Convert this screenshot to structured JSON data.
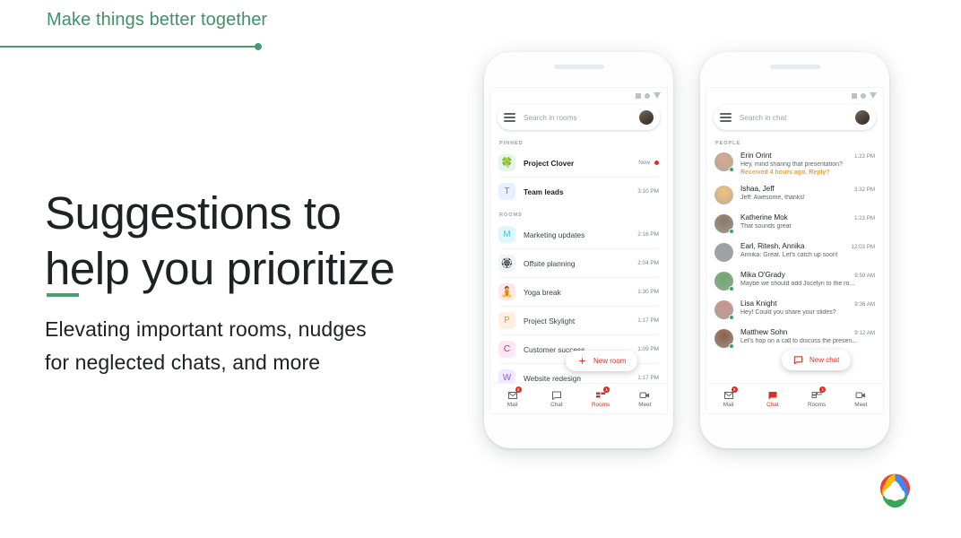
{
  "header": {
    "kicker": "Make things better together"
  },
  "hero": {
    "headline_line1": "Suggestions to",
    "headline_line2": "help you prioritize",
    "subcopy_line1": "Elevating important rooms, nudges",
    "subcopy_line2": "for neglected chats, and more"
  },
  "colors": {
    "green_accent": "#4a9d6e",
    "red_accent": "#d93025",
    "nudge_amber": "#e8a33d",
    "text_primary": "#202124",
    "text_secondary": "#5f6368"
  },
  "phone_left": {
    "app": "rooms",
    "search": {
      "placeholder": "Search in rooms",
      "menu_icon": "hamburger-icon",
      "avatar_icon": "user-avatar"
    },
    "sections": [
      {
        "label": "PINNED",
        "rows": [
          {
            "tile": "🍀",
            "tile_type": "emoji",
            "tile_bg": "#e6f4ea",
            "name": "Project Clover",
            "time": "Now",
            "unread": true,
            "bold": true
          },
          {
            "tile": "T",
            "tile_type": "letter",
            "tile_bg": "#e8f0fe",
            "tile_fg": "#4285f4",
            "name": "Team leads",
            "time": "3:10 PM",
            "unread": false,
            "bold": true
          }
        ]
      },
      {
        "label": "ROOMS",
        "rows": [
          {
            "tile": "M",
            "tile_type": "letter",
            "tile_bg": "#e0f7fa",
            "tile_fg": "#4fc3d7",
            "name": "Marketing updates",
            "time": "2:16 PM",
            "unread": false,
            "bold": false
          },
          {
            "tile": "🏵",
            "tile_type": "emoji",
            "tile_bg": "#f1f3f4",
            "name": "Offsite planning",
            "time": "2:04 PM",
            "unread": false,
            "bold": false
          },
          {
            "tile": "🧘",
            "tile_type": "emoji",
            "tile_bg": "#fce8e6",
            "name": "Yoga break",
            "time": "1:30 PM",
            "unread": false,
            "bold": false
          },
          {
            "tile": "P",
            "tile_type": "letter",
            "tile_bg": "#feefe3",
            "tile_fg": "#f29900",
            "name": "Project Skylight",
            "time": "1:17 PM",
            "unread": false,
            "bold": false
          },
          {
            "tile": "C",
            "tile_type": "letter",
            "tile_bg": "#fde7f3",
            "tile_fg": "#d81b87",
            "name": "Customer success",
            "time": "1:09 PM",
            "unread": false,
            "bold": false
          },
          {
            "tile": "W",
            "tile_type": "letter",
            "tile_bg": "#f3e8fd",
            "tile_fg": "#8e63ce",
            "name": "Website redesign",
            "time": "1:17 PM",
            "unread": false,
            "bold": false
          }
        ]
      }
    ],
    "fab": {
      "label": "New room",
      "icon": "plus-icon"
    },
    "bottom_nav": [
      {
        "label": "Mail",
        "icon": "mail-icon",
        "badge": "2",
        "active": false
      },
      {
        "label": "Chat",
        "icon": "chat-icon",
        "badge": "",
        "active": false
      },
      {
        "label": "Rooms",
        "icon": "rooms-icon",
        "badge": "1",
        "active": true
      },
      {
        "label": "Meet",
        "icon": "meet-icon",
        "badge": "",
        "active": false
      }
    ]
  },
  "phone_right": {
    "app": "chat",
    "search": {
      "placeholder": "Search in chat",
      "menu_icon": "hamburger-icon",
      "avatar_icon": "user-avatar"
    },
    "section_label": "PEOPLE",
    "chats": [
      {
        "name": "Erin Orint",
        "time": "1:23 PM",
        "message": "Hey, mind sharing that presentation?",
        "nudge": "Received 4 hours ago. Reply?",
        "presence": true,
        "avatar_bg": "#d9a88f"
      },
      {
        "name": "Ishaa, Jeff",
        "time": "3:32 PM",
        "message": "Jeff: Awesome, thanks!",
        "nudge": "",
        "presence": false,
        "avatar_bg": "#f0c27b"
      },
      {
        "name": "Katherine Mok",
        "time": "1:23 PM",
        "message": "That sounds great",
        "nudge": "",
        "presence": true,
        "avatar_bg": "#8a7a66"
      },
      {
        "name": "Earl, Ritesh, Annika",
        "time": "12:03 PM",
        "message": "Annika: Great. Let's catch up soon!",
        "nudge": "",
        "presence": false,
        "avatar_bg": "#9aa0a6"
      },
      {
        "name": "Mika O'Grady",
        "time": "9:59 AM",
        "message": "Maybe we should add Jocelyn to the ro...",
        "nudge": "",
        "presence": true,
        "avatar_bg": "#6fa86f"
      },
      {
        "name": "Lisa Knight",
        "time": "9:36 AM",
        "message": "Hey! Could you share your slides?",
        "nudge": "",
        "presence": true,
        "avatar_bg": "#c9948c"
      },
      {
        "name": "Matthew Sohn",
        "time": "9:12 AM",
        "message": "Let's hop on a call to discuss the presen...",
        "nudge": "",
        "presence": true,
        "avatar_bg": "#8d5f4a"
      }
    ],
    "fab": {
      "label": "New chat",
      "icon": "chat-bubble-icon"
    },
    "bottom_nav": [
      {
        "label": "Mail",
        "icon": "mail-icon",
        "badge": "2",
        "active": false
      },
      {
        "label": "Chat",
        "icon": "chat-icon",
        "badge": "",
        "active": true
      },
      {
        "label": "Rooms",
        "icon": "rooms-icon",
        "badge": "1",
        "active": false
      },
      {
        "label": "Meet",
        "icon": "meet-icon",
        "badge": "",
        "active": false
      }
    ]
  },
  "logo": {
    "name": "google-cloud-logo"
  }
}
